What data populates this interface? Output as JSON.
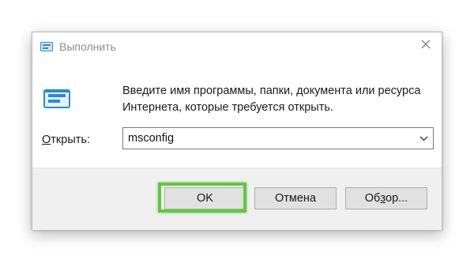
{
  "window": {
    "title": "Выполнить",
    "icon": "run-app-icon",
    "close_glyph": "✕"
  },
  "content": {
    "icon": "run-app-icon",
    "description_line1": "Введите имя программы, папки, документа или ресурса",
    "description_line2": "Интернета, которые требуется открыть.",
    "open_label_hotkey": "О",
    "open_label_rest": "ткрыть:",
    "input_value": "msconfig"
  },
  "buttons": {
    "ok": "OK",
    "cancel": "Отмена",
    "browse_pre": "Об",
    "browse_hotkey": "з",
    "browse_post": "ор..."
  },
  "colors": {
    "highlight": "#5fc93c",
    "icon_blue": "#2a8ad4",
    "footer_bg": "#f0f0f0"
  }
}
